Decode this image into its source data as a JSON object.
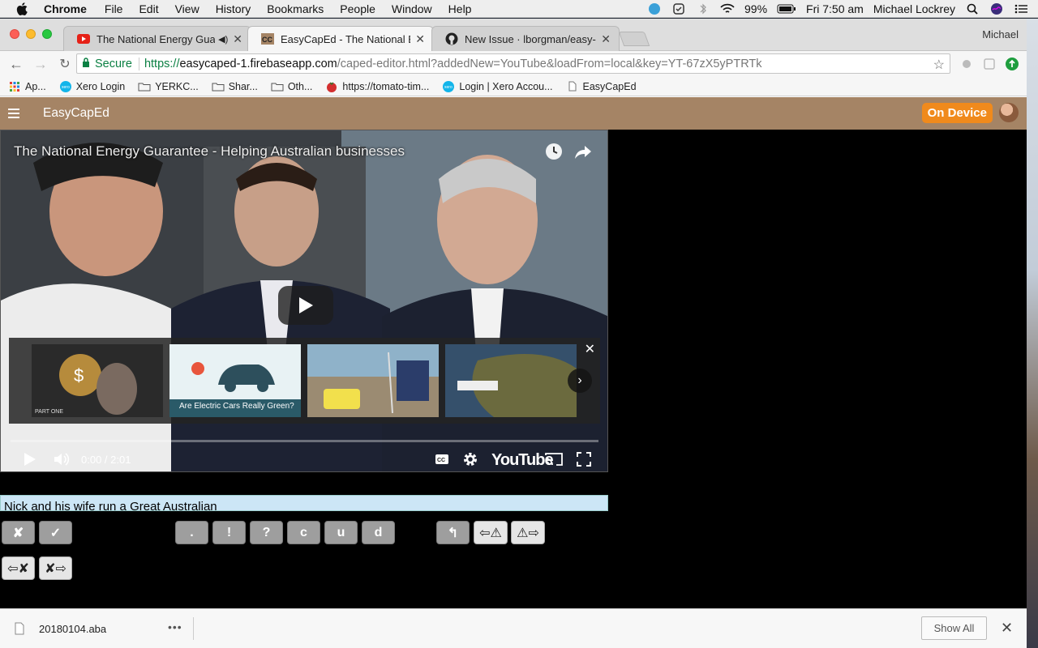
{
  "menubar": {
    "app_name": "Chrome",
    "menus": [
      "File",
      "Edit",
      "View",
      "History",
      "Bookmarks",
      "People",
      "Window",
      "Help"
    ],
    "battery": "99%",
    "clock": "Fri 7:50 am",
    "user": "Michael Lockrey"
  },
  "browser": {
    "tabs": [
      {
        "title": "The National Energy Guarantee",
        "favicon": "youtube-icon"
      },
      {
        "title": "EasyCapEd - The National Energy",
        "favicon": "easycaped-icon"
      },
      {
        "title": "New Issue · lborgman/easy-capt",
        "favicon": "github-icon"
      }
    ],
    "profile_name": "Michael",
    "secure_label": "Secure",
    "url_scheme": "https://",
    "url_host": "easycaped-1.firebaseapp.com",
    "url_rest": "/caped-editor.html?addedNew=YouTube&loadFrom=local&key=YT-67zX5yPTRTk",
    "bookmarks": [
      {
        "label": "Ap...",
        "icon": "apps-grid-icon"
      },
      {
        "label": "Xero Login",
        "icon": "xero-icon"
      },
      {
        "label": "YERKC...",
        "icon": "folder-icon"
      },
      {
        "label": "Shar...",
        "icon": "folder-icon"
      },
      {
        "label": "Oth...",
        "icon": "folder-icon"
      },
      {
        "label": "https://tomato-tim...",
        "icon": "tomato-icon"
      },
      {
        "label": "Login | Xero Accou...",
        "icon": "xero-icon"
      },
      {
        "label": "EasyCapEd",
        "icon": "page-icon"
      }
    ]
  },
  "app": {
    "title": "EasyCapEd",
    "mode_badge": "On Device"
  },
  "video": {
    "title": "The National Energy Guarantee - Helping Australian businesses",
    "time_current": "0:00",
    "time_sep": " / ",
    "time_total": "2:01",
    "brand": "YouTube",
    "progress_fraction": 0.0,
    "endscreen": [
      {
        "caption": "PART ONE"
      },
      {
        "caption": "Are Electric Cars Really Green?"
      },
      {
        "caption": ""
      },
      {
        "caption": ""
      }
    ]
  },
  "caption": {
    "text": "Nick and his wife run a Great Australian"
  },
  "buttons": {
    "row1_left": [
      "✘",
      "✓"
    ],
    "row1_mid": [
      ".",
      "!",
      "?",
      "c",
      "u",
      "d"
    ],
    "row1_right": [
      "↰",
      "⇦⚠",
      "⚠⇨"
    ],
    "row2": [
      "⇦✘",
      "✘⇨"
    ]
  },
  "downloads": {
    "file": "20180104.aba",
    "show_all": "Show All"
  }
}
